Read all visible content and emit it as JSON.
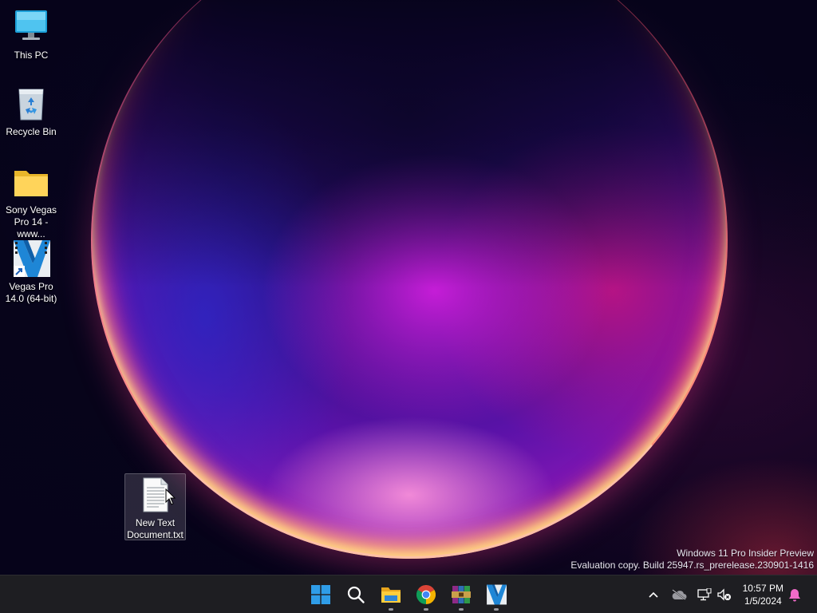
{
  "desktop": {
    "icons": [
      {
        "label": "This PC",
        "icon": "computer-icon"
      },
      {
        "label": "Recycle Bin",
        "icon": "recycle-bin-icon"
      },
      {
        "label": "Sony Vegas Pro 14 - www...",
        "icon": "folder-icon"
      },
      {
        "label": "Vegas Pro 14.0 (64-bit)",
        "icon": "vegas-pro-icon"
      },
      {
        "label": "New Text Document.txt",
        "icon": "text-document-icon",
        "selected": true
      }
    ],
    "watermark": {
      "line1": "Windows 11 Pro Insider Preview",
      "line2": "Evaluation copy. Build 25947.rs_prerelease.230901-1416"
    }
  },
  "taskbar": {
    "apps": [
      {
        "name": "Start",
        "icon": "windows-start-icon",
        "running": false
      },
      {
        "name": "Search",
        "icon": "search-icon",
        "running": false
      },
      {
        "name": "File Explorer",
        "icon": "file-explorer-icon",
        "running": true
      },
      {
        "name": "Google Chrome",
        "icon": "chrome-icon",
        "running": true
      },
      {
        "name": "WinRAR",
        "icon": "winrar-icon",
        "running": true
      },
      {
        "name": "Vegas Pro",
        "icon": "vegas-pro-icon",
        "running": true
      }
    ],
    "tray": {
      "icons": [
        "chevron-up-icon",
        "onedrive-icon",
        "network-icon",
        "volume-muted-icon",
        "notification-bell-icon"
      ],
      "time": "10:57 PM",
      "date": "1/5/2024"
    }
  },
  "colors": {
    "taskbar_bg": "#1e1e22",
    "accent": "#2f9de8",
    "orb_magenta": "#c21ad8",
    "notification_badge": "#f06ac8"
  }
}
